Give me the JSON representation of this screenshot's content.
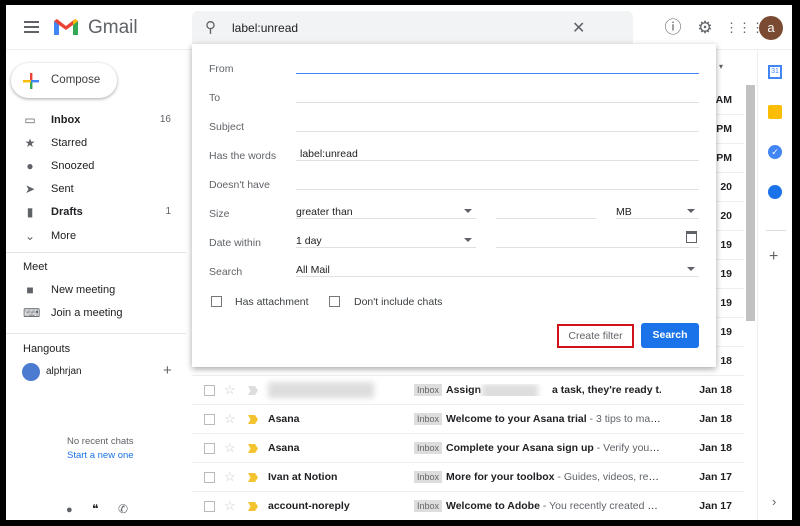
{
  "header": {
    "app_name": "Gmail",
    "search_query": "label:unread",
    "avatar_letter": "a"
  },
  "compose": "Compose",
  "nav": [
    {
      "label": "Inbox",
      "count": "16",
      "icon": "inbox-icon",
      "bold": true
    },
    {
      "label": "Starred",
      "count": "",
      "icon": "star-icon"
    },
    {
      "label": "Snoozed",
      "count": "",
      "icon": "clock-icon"
    },
    {
      "label": "Sent",
      "count": "",
      "icon": "send-icon"
    },
    {
      "label": "Drafts",
      "count": "1",
      "icon": "draft-icon",
      "bold": true
    },
    {
      "label": "More",
      "count": "",
      "icon": "chevron-down-icon"
    }
  ],
  "meet": {
    "title": "Meet",
    "new_meeting": "New meeting",
    "join": "Join a meeting"
  },
  "hangouts": {
    "title": "Hangouts",
    "user": "alphrjan",
    "no_chats": "No recent chats",
    "start": "Start a new one"
  },
  "filter": {
    "from_label": "From",
    "to_label": "To",
    "subject_label": "Subject",
    "has_words_label": "Has the words",
    "has_words_value": "label:unread",
    "doesnt_have_label": "Doesn't have",
    "size_label": "Size",
    "size_op": "greater than",
    "size_unit": "MB",
    "date_label": "Date within",
    "date_value": "1 day",
    "search_label": "Search",
    "search_value": "All Mail",
    "has_attachment": "Has attachment",
    "no_chats": "Don't include chats",
    "create_filter": "Create filter",
    "search_button": "Search"
  },
  "hidden_dates": [
    "AM",
    "PM",
    "PM",
    "20",
    "20",
    "19",
    "19",
    "19",
    "19",
    "18"
  ],
  "emails": [
    {
      "sender": "",
      "tag": "Inbox",
      "subject": "Assign",
      "subject2": "a task, they're ready t...",
      "snippet": "",
      "date": "Jan 18",
      "important": false,
      "blurred": true
    },
    {
      "sender": "Asana",
      "tag": "Inbox",
      "subject": "Welcome to your Asana trial",
      "snippet": " - 3 tips to mast...",
      "date": "Jan 18",
      "important": true
    },
    {
      "sender": "Asana",
      "tag": "Inbox",
      "subject": "Complete your Asana sign up",
      "snippet": " - Verify your e...",
      "date": "Jan 18",
      "important": true
    },
    {
      "sender": "Ivan at Notion",
      "tag": "Inbox",
      "subject": "More for your toolbox",
      "snippet": " - Guides, videos, resou...",
      "date": "Jan 17",
      "important": true
    },
    {
      "sender": "account-noreply",
      "tag": "Inbox",
      "subject": "Welcome to Adobe",
      "snippet": " - You recently created an ...",
      "date": "Jan 17",
      "important": true
    }
  ],
  "colors": {
    "accent": "#1a73e8",
    "highlight": "#d0121b",
    "important": "#f4c430"
  }
}
